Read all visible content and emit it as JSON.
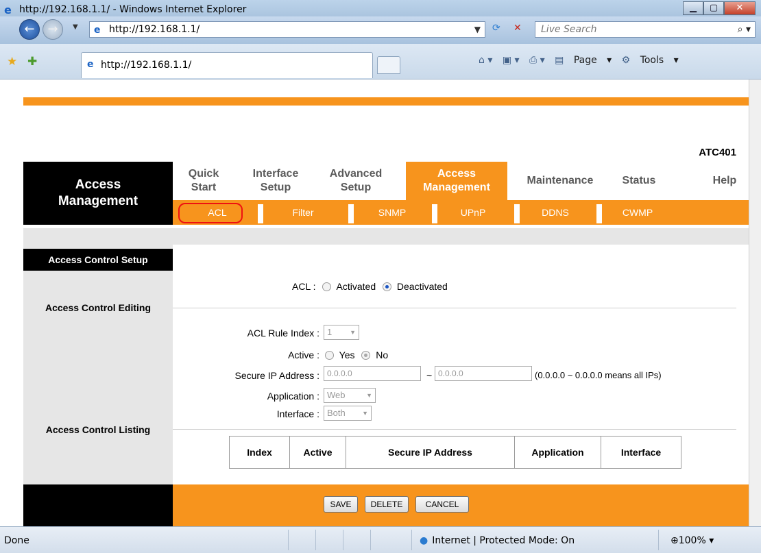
{
  "browser": {
    "window_title": "http://192.168.1.1/ - Windows Internet Explorer",
    "address": "http://192.168.1.1/",
    "search_placeholder": "Live Search",
    "tab_title": "http://192.168.1.1/",
    "commands": {
      "page": "Page",
      "tools": "Tools"
    },
    "status_text": "Done",
    "zone_text": "Internet | Protected Mode: On",
    "zoom": "100%"
  },
  "router": {
    "model": "ATC401",
    "section_title_line1": "Access",
    "section_title_line2": "Management",
    "menu": [
      {
        "line1": "Quick",
        "line2": "Start"
      },
      {
        "line1": "Interface",
        "line2": "Setup"
      },
      {
        "line1": "Advanced",
        "line2": "Setup"
      },
      {
        "line1": "Access",
        "line2": "Management"
      },
      {
        "line1": "Maintenance",
        "line2": ""
      },
      {
        "line1": "Status",
        "line2": ""
      },
      {
        "line1": "Help",
        "line2": ""
      }
    ],
    "submenu": [
      "ACL",
      "Filter",
      "SNMP",
      "UPnP",
      "DDNS",
      "CWMP"
    ],
    "left": {
      "header": "Access Control Setup",
      "editing": "Access Control Editing",
      "listing": "Access Control Listing"
    },
    "acl": {
      "label": "ACL :",
      "activated": "Activated",
      "deactivated": "Deactivated",
      "selected": "Deactivated"
    },
    "form": {
      "rule_index_label": "ACL Rule Index :",
      "rule_index_value": "1",
      "active_label": "Active :",
      "yes": "Yes",
      "no": "No",
      "secure_ip_label": "Secure IP Address :",
      "ip_from": "0.0.0.0",
      "tilde": "~",
      "ip_to": "0.0.0.0",
      "ip_note": "(0.0.0.0 ~ 0.0.0.0 means all IPs)",
      "application_label": "Application :",
      "application_value": "Web",
      "interface_label": "Interface :",
      "interface_value": "Both"
    },
    "table_headers": [
      "Index",
      "Active",
      "Secure IP Address",
      "Application",
      "Interface"
    ],
    "buttons": {
      "save": "SAVE",
      "delete": "DELETE",
      "cancel": "CANCEL"
    },
    "colors": {
      "accent": "#f7941d",
      "black": "#000000",
      "grey": "#e6e6e6"
    }
  }
}
